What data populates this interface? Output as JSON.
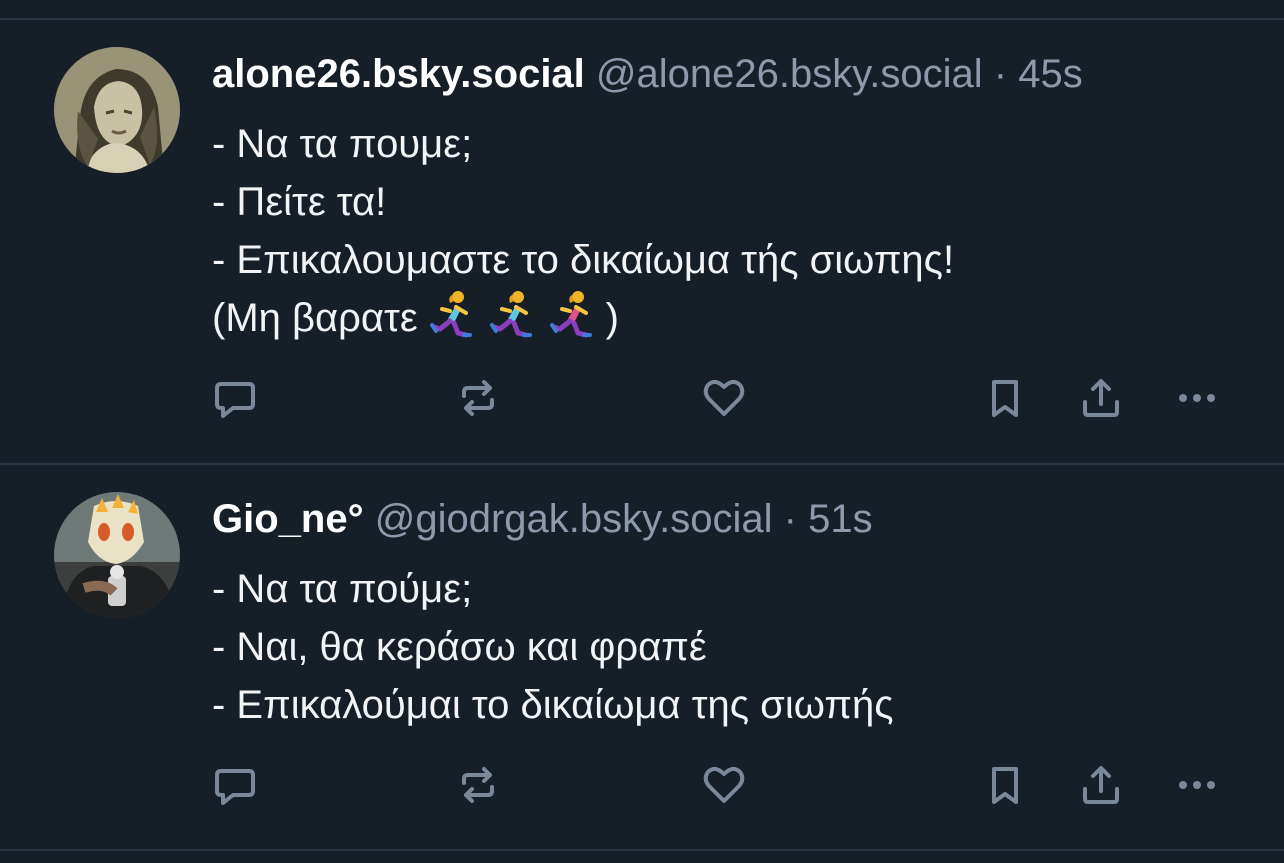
{
  "colors": {
    "background": "#161e27",
    "divider": "#2b3542",
    "text": "#f1f3f5",
    "muted": "#8e9aab",
    "icon": "#7b8899"
  },
  "posts": [
    {
      "display_name": "alone26.bsky.social",
      "handle": "@alone26.bsky.social",
      "separator": "·",
      "time": "45s",
      "lines": [
        "- Να τα πουμε;",
        "- Πείτε τα!",
        "- Επικαλουμαστε το δικαίωμα τής σιωπης!",
        "(Μη βαρατε",
        ")"
      ],
      "emoji": [
        "woman-running-icon",
        "woman-running-icon",
        "woman-running-icon"
      ],
      "actions": [
        "reply-icon",
        "repost-icon",
        "like-icon",
        "bookmark-icon",
        "share-icon",
        "more-icon"
      ]
    },
    {
      "display_name": "Gio_ne°",
      "handle": "@giodrgak.bsky.social",
      "separator": "·",
      "time": "51s",
      "lines": [
        "- Να τα πούμε;",
        "- Ναι, θα κεράσω και φραπέ",
        "- Επικαλούμαι το δικαίωμα της σιωπής"
      ],
      "actions": [
        "reply-icon",
        "repost-icon",
        "like-icon",
        "bookmark-icon",
        "share-icon",
        "more-icon"
      ]
    }
  ]
}
